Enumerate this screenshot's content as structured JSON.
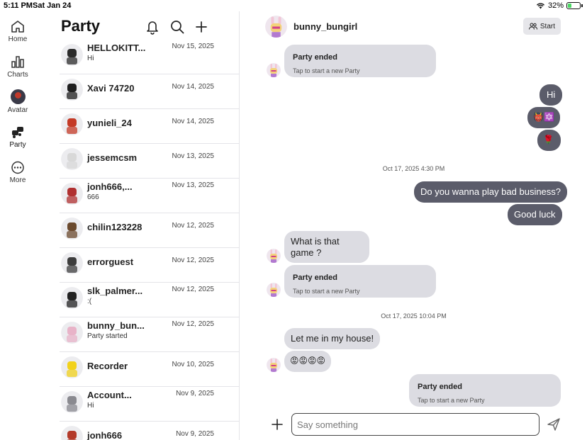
{
  "status_bar": {
    "time": "5:11 PM",
    "date": "Sat Jan 24",
    "battery": "32%",
    "battery_level": 0.32
  },
  "nav": [
    {
      "label": "Home",
      "icon": "home-icon"
    },
    {
      "label": "Charts",
      "icon": "charts-icon"
    },
    {
      "label": "Avatar",
      "icon": "avatar-icon"
    },
    {
      "label": "Party",
      "icon": "party-icon"
    },
    {
      "label": "More",
      "icon": "more-icon"
    }
  ],
  "list": {
    "title": "Party",
    "header_icons": [
      "bell-icon",
      "search-icon",
      "plus-icon"
    ],
    "rows": [
      {
        "name": "HELLOKITT...",
        "sub": "Hi",
        "date": "Nov 15, 2025",
        "avatar_color": "#2b2b2b"
      },
      {
        "name": "Xavi 74720",
        "sub": "",
        "date": "Nov 14, 2025",
        "avatar_color": "#1e1e1e"
      },
      {
        "name": "yunieli_24",
        "sub": "",
        "date": "Nov 14, 2025",
        "avatar_color": "#c43a26"
      },
      {
        "name": "jessemcsm",
        "sub": "",
        "date": "Nov 13, 2025",
        "avatar_color": "#d8d8d8"
      },
      {
        "name": "jonh666,...",
        "sub": "666",
        "date": "Nov 13, 2025",
        "avatar_color": "#b03030"
      },
      {
        "name": "chilin123228",
        "sub": "",
        "date": "Nov 12, 2025",
        "avatar_color": "#6b4a2e"
      },
      {
        "name": "errorguest",
        "sub": "",
        "date": "Nov 12, 2025",
        "avatar_color": "#3d3d3d"
      },
      {
        "name": "slk_palmer...",
        "sub": ":(",
        "date": "Nov 12, 2025",
        "avatar_color": "#222222"
      },
      {
        "name": "bunny_bun...",
        "sub": "Party started",
        "date": "Nov 12, 2025",
        "avatar_color": "#e8b3c8"
      },
      {
        "name": "Recorder",
        "sub": "",
        "date": "Nov 10, 2025",
        "avatar_color": "#f2d21b"
      },
      {
        "name": "Account...",
        "sub": "Hi",
        "date": "Nov 9, 2025",
        "avatar_color": "#8a8a90"
      },
      {
        "name": "jonh666",
        "sub": "",
        "date": "Nov 9, 2025",
        "avatar_color": "#b33a2a"
      }
    ]
  },
  "chat": {
    "name": "bunny_bungirl",
    "start_label": "Start",
    "party_ended_title": "Party ended",
    "party_ended_sub": "Tap to start a new Party",
    "messages": {
      "hi": "Hi",
      "emoji_devil": "👹🔯",
      "rose": "🌹",
      "stamp1": "Oct 17, 2025 4:30 PM",
      "q1": "Do you wanna play bad business?",
      "good_luck": "Good luck",
      "what_game": "What is that game ?",
      "stamp2": "Oct 17, 2025 10:04 PM",
      "let_me_in": "Let me in my house!",
      "angry": "😡😡😡😡"
    },
    "composer_placeholder": "Say something"
  },
  "colors": {
    "incoming_bubble": "#dcdce2",
    "outgoing_bubble": "#5b5c6a",
    "divider": "#e4e4e8"
  }
}
